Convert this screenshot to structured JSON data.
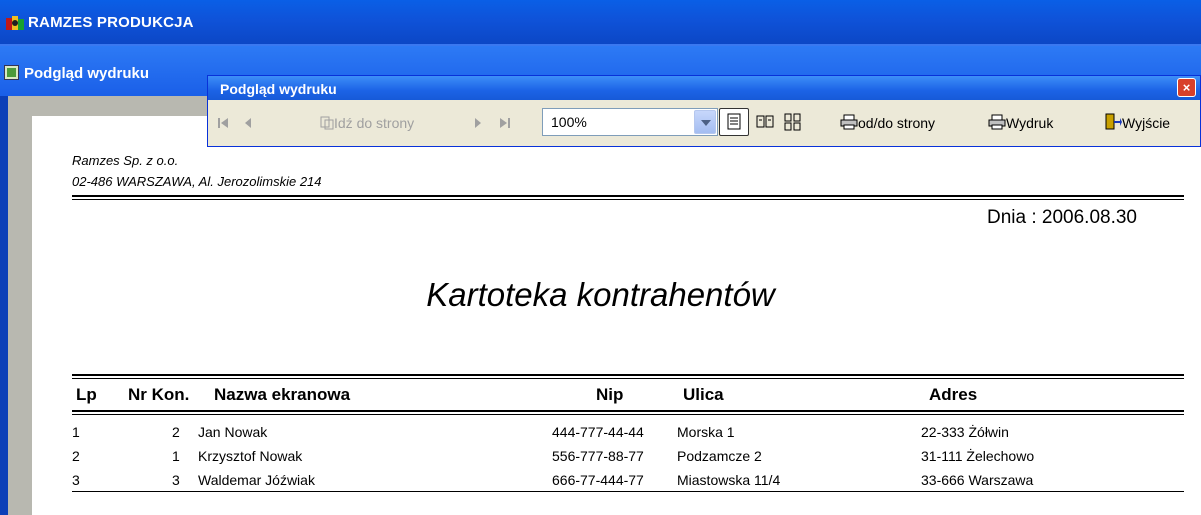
{
  "app": {
    "title": "RAMZES PRODUKCJA"
  },
  "mdi": {
    "title": "Podgląd wydruku"
  },
  "toolbar_window": {
    "title": "Podgląd wydruku",
    "close": "×",
    "goto_label": "Idź do strony",
    "zoom_value": "100%",
    "range_label": "od/do strony",
    "print_label": "Wydruk",
    "exit_label": "Wyjście"
  },
  "document": {
    "company_name": "Ramzes Sp. z o.o.",
    "company_address": "02-486 WARSZAWA, Al. Jerozolimskie 214",
    "date_text": "Dnia : 2006.08.30",
    "title": "Kartoteka kontrahentów",
    "columns": [
      "Lp",
      "Nr Kon.",
      "Nazwa ekranowa",
      "Nip",
      "Ulica",
      "Adres"
    ],
    "rows": [
      {
        "lp": "1",
        "nr": "2",
        "nazwa": "Jan Nowak",
        "nip": "444-777-44-44",
        "ulica": "Morska 1",
        "adres": "22-333 Żółwin"
      },
      {
        "lp": "2",
        "nr": "1",
        "nazwa": "Krzysztof Nowak",
        "nip": "556-777-88-77",
        "ulica": "Podzamcze 2",
        "adres": "31-111 Żelechowo"
      },
      {
        "lp": "3",
        "nr": "3",
        "nazwa": "Waldemar Jóźwiak",
        "nip": "666-77-444-77",
        "ulica": "Miastowska 11/4",
        "adres": "33-666 Warszawa"
      }
    ]
  },
  "colors": {
    "titlebar": "#0b46c4",
    "toolbar_bg": "#ece9d8",
    "page_bg": "#ffffff",
    "gutter": "#b8b8b0"
  }
}
